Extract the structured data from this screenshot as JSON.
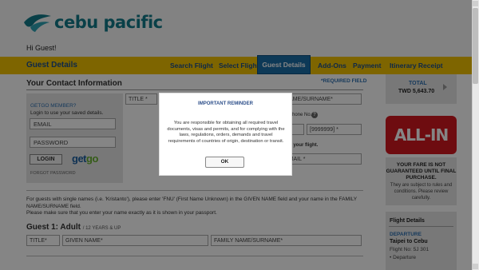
{
  "brand": {
    "name": "cebu pacific",
    "color": "#137c8a",
    "accent": "#f2c200",
    "logo_icon": "bird-logo-icon"
  },
  "greeting": "Hi Guest!",
  "nav": {
    "section_title": "Guest Details",
    "items": [
      {
        "label": "Search Flight"
      },
      {
        "label": "Select Flight"
      },
      {
        "label": "Guest Details",
        "active": true
      },
      {
        "label": "Add-Ons"
      },
      {
        "label": "Payment"
      },
      {
        "label": "Itinerary Receipt"
      }
    ]
  },
  "contact": {
    "heading": "Your Contact Information",
    "required_note": "*REQUIRED FIELD",
    "member": {
      "title": "GETGO MEMBER?",
      "subtitle": "Login to use your saved details.",
      "email_placeholder": "EMAIL",
      "password_placeholder": "PASSWORD",
      "login_label": "LOGIN",
      "getgo_logo": "getgo",
      "forgot_label": "FORGOT PASSWORD"
    },
    "title_select": "TITLE *",
    "name_field": "NAME/SURNAME*",
    "phone_label": "hone No.",
    "help_icon": "?",
    "code_field": "] *",
    "phone_field": "[9999999] *",
    "flight_note": "n your flight.",
    "email_field": "EMAIL *"
  },
  "notes": {
    "single_names": "For guests with single names (i.e. 'Kristanto'), please enter 'FNU' (First Name Unknown) in the GIVEN NAME field and your name in the FAMILY NAME/SURNAME field.",
    "passport": "Please make sure that you enter your name exactly as it is shown in your passport."
  },
  "guest1": {
    "heading": "Guest 1: Adult",
    "age_note": "/ 12 YEARS & UP",
    "title_select": "TITLE*",
    "given_name": "GIVEN NAME*",
    "family_name": "FAMILY NAME/SURNAME*"
  },
  "summary": {
    "total_label": "TOTAL",
    "total_value": "TWD 5,643.70",
    "allin_label": "ALL-IN",
    "fare_bold": "YOUR FARE IS NOT GUARANTEED UNTIL FINAL PURCHASE.",
    "fare_small": "They are subject to rules and conditions. Please review carefully.",
    "flight_details_heading": "Flight Details",
    "departure_label": "DEPARTURE",
    "route": "Taipei to Cebu",
    "flight_no": "Flight No: 5J 301",
    "departure_line": "• Departure"
  },
  "modal": {
    "title": "IMPORTANT REMINDER",
    "body": "You are responsible for obtaining all required travel documents, visas and permits, and for complying with the laws, regulations, orders, demands and travel requirements of countries of origin, destination or transit.",
    "ok_label": "OK"
  }
}
